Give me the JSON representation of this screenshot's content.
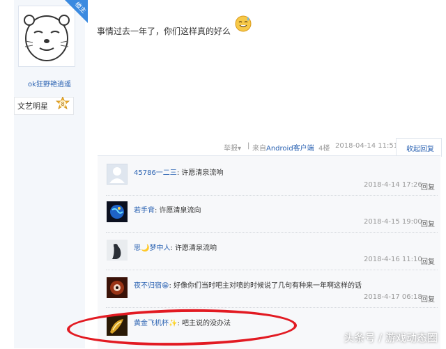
{
  "author": {
    "badge": "楼主",
    "username": "ok狂野艳逍遥",
    "rank_title": "文艺明星",
    "rank_level": "8"
  },
  "post": {
    "text": "事情过去一年了，你们这样真的好么",
    "emoji_icon": "sweat-smile-emoji"
  },
  "tail": {
    "report": "举报",
    "source_prefix": "来自",
    "source_link": "Android客户端",
    "floor": "4楼",
    "datetime": "2018-04-14 11:51",
    "collapse_reply": "收起回复"
  },
  "replies": [
    {
      "name": "45786一二三",
      "text": ": 许愿清泉流响",
      "time": "2018-4-14 17:26",
      "action": "回复",
      "avatar": "default-avatar"
    },
    {
      "name": "若手背",
      "text": ": 许愿清泉流向",
      "time": "2018-4-15 19:00",
      "action": "回复",
      "avatar": "earth-avatar"
    },
    {
      "name": "思🌙梦中人",
      "text": ": 许愿清泉流响",
      "time": "2018-4-16 11:10",
      "action": "回复",
      "avatar": "figure-avatar"
    },
    {
      "name": "夜不归宿😁",
      "text": ": 好像你们当时吧主对喷的时候说了几句有种来一年啊这样的话",
      "time": "2018-4-17 06:18",
      "action": "回复",
      "avatar": "eye-avatar"
    },
    {
      "name": "黄金飞机杯✨",
      "text": ": 吧主说的没办法",
      "time": "",
      "action": "",
      "avatar": "gold-avatar"
    }
  ],
  "watermark": "头条号 / 游戏动态圈",
  "colors": {
    "link": "#2d64b3",
    "badge": "#3b8ae0",
    "highlight": "#e21a22"
  }
}
